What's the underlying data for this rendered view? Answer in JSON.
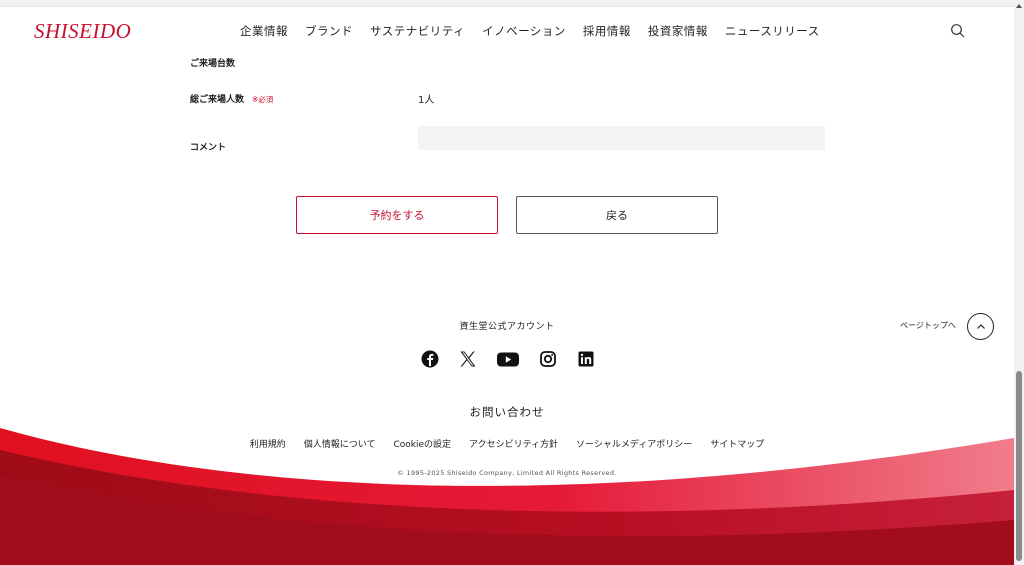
{
  "header": {
    "logo_text": "SHISEIDO",
    "nav": [
      "企業情報",
      "ブランド",
      "サステナビリティ",
      "イノベーション",
      "採用情報",
      "投資家情報",
      "ニュースリリース"
    ]
  },
  "form": {
    "vehicles_label": "ご来場台数",
    "total_visitors_label": "総ご来場人数",
    "required_mark": "※必須",
    "total_visitors_value": "1人",
    "comment_label": "コメント",
    "comment_value": "",
    "reserve_button": "予約をする",
    "back_button": "戻る"
  },
  "footer": {
    "accounts_title": "資生堂公式アカウント",
    "social_icons": [
      "facebook-icon",
      "x-icon",
      "youtube-icon",
      "instagram-icon",
      "linkedin-icon"
    ],
    "page_top_label": "ページトップへ",
    "contact": "お問い合わせ",
    "links": [
      "利用規約",
      "個人情報について",
      "Cookieの設定",
      "アクセシビリティ方針",
      "ソーシャルメディアポリシー",
      "サイトマップ"
    ],
    "copyright": "© 1995-2025 Shiseido Company, Limited All Rights Reserved."
  },
  "colors": {
    "brand_red": "#c8102e",
    "wave_dark": "#a50f1f",
    "wave_light": "#ee8a96"
  }
}
